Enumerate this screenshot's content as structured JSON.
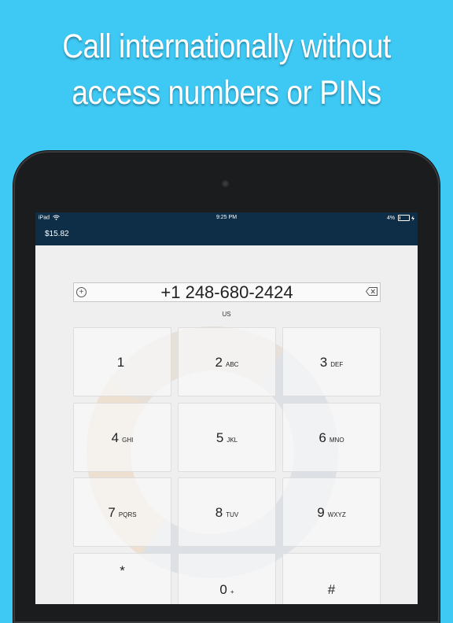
{
  "headline": {
    "line1": "Call internationally without",
    "line2": "access numbers or PINs"
  },
  "colors": {
    "background": "#3ec8f4",
    "appbar": "#0d2e46",
    "device": "#1b1c1e"
  },
  "status_bar": {
    "device": "iPad",
    "time": "9:25 PM",
    "battery": "4%",
    "icons": [
      "wifi-icon",
      "battery-icon",
      "charging-icon"
    ]
  },
  "app": {
    "balance": "$15.82"
  },
  "dialer": {
    "number": "+1 248-680-2424",
    "country": "US",
    "icons": [
      "add-contact-icon",
      "backspace-icon"
    ],
    "keys": [
      {
        "digit": "1",
        "letters": ""
      },
      {
        "digit": "2",
        "letters": "ABC"
      },
      {
        "digit": "3",
        "letters": "DEF"
      },
      {
        "digit": "4",
        "letters": "GHI"
      },
      {
        "digit": "5",
        "letters": "JKL"
      },
      {
        "digit": "6",
        "letters": "MNO"
      },
      {
        "digit": "7",
        "letters": "PQRS"
      },
      {
        "digit": "8",
        "letters": "TUV"
      },
      {
        "digit": "9",
        "letters": "WXYZ"
      },
      {
        "digit": "*",
        "letters": ""
      },
      {
        "digit": "0",
        "letters": "+"
      },
      {
        "digit": "#",
        "letters": ""
      }
    ]
  }
}
